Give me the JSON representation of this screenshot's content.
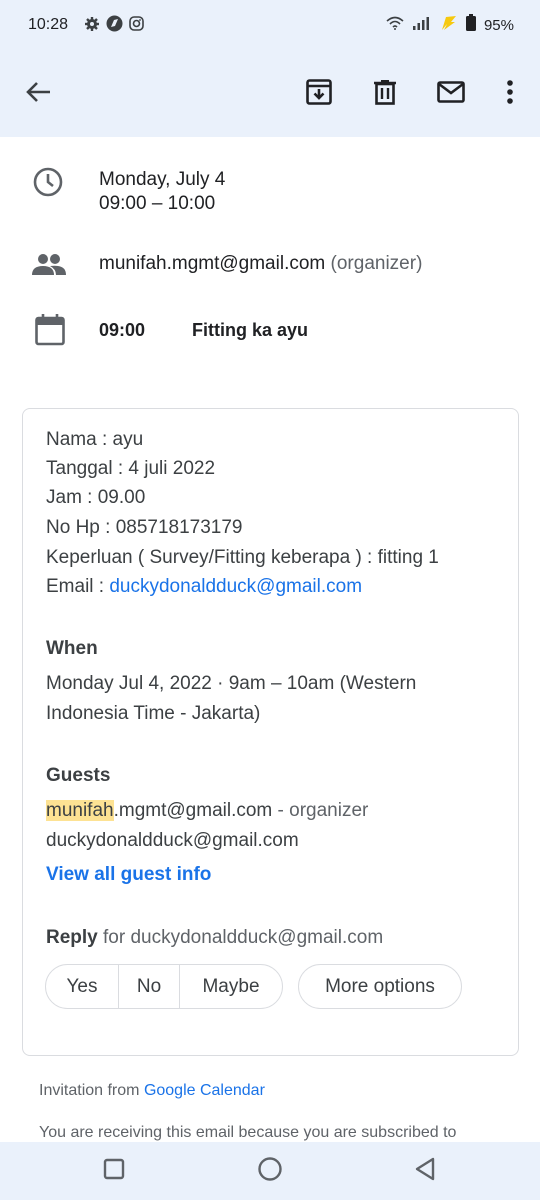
{
  "status_bar": {
    "time": "10:28",
    "battery": "95%",
    "icons": [
      "gear-icon",
      "location-icon",
      "instagram-icon",
      "wifi-icon",
      "signal-icon",
      "lightning-icon",
      "battery-icon"
    ]
  },
  "toolbar": {
    "icons": [
      "back-arrow-icon",
      "archive-icon",
      "delete-icon",
      "mail-icon",
      "more-vert-icon"
    ]
  },
  "event": {
    "date": "Monday, July 4",
    "time_range": "09:00 – 10:00",
    "organizer_email": "munifah.mgmt@gmail.com",
    "organizer_role": "(organizer)",
    "calendar_time": "09:00",
    "calendar_title": "Fitting ka ayu"
  },
  "body": {
    "lines": {
      "nama": "Nama : ayu",
      "tanggal": "Tanggal : 4 juli 2022",
      "jam": "Jam : 09.00",
      "no_hp": "No Hp : 085718173179",
      "keperluan": "Keperluan ( Survey/Fitting keberapa ) : fitting 1",
      "email_label": "Email : ",
      "email_value": "duckydonaldduck@gmail.com"
    },
    "when_heading": "When",
    "when_line1": "Monday Jul 4, 2022 · 9am – 10am (Western",
    "when_line2": "Indonesia Time - Jakarta)",
    "guests_heading": "Guests",
    "guest1_highlight": "munifah",
    "guest1_rest": ".mgmt@gmail.com",
    "guest1_role": " - organizer",
    "guest2": "duckydonaldduck@gmail.com",
    "view_all": "View all guest info",
    "reply_label": "Reply",
    "reply_for": " for duckydonaldduck@gmail.com",
    "reply_yes": "Yes",
    "reply_no": "No",
    "reply_maybe": "Maybe",
    "more_options": "More options"
  },
  "footer": {
    "invitation_prefix": "Invitation from ",
    "invitation_link": "Google Calendar",
    "subscribed_text": "You are receiving this email because you are subscribed to"
  },
  "colors": {
    "link": "#1a73e8",
    "highlight": "#fde293",
    "chrome_bg": "#eaf1fb"
  }
}
